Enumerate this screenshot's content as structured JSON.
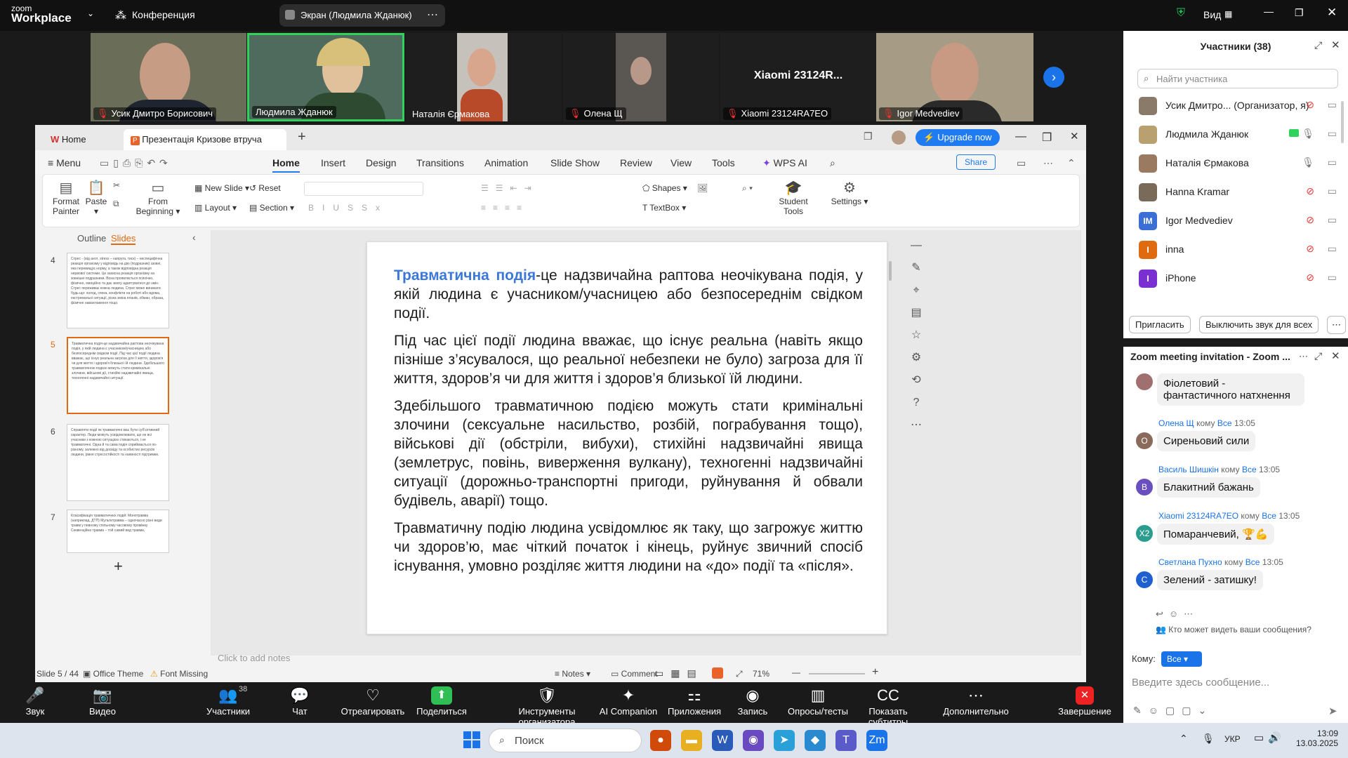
{
  "zoom": {
    "logo_top": "zoom",
    "logo_bottom": "Workplace",
    "conference_label": "Конференция",
    "screen_label": "Экран (Людмила Жданюк)",
    "view_label": "Вид",
    "participants": [
      {
        "name": "Усик Дмитро Борисович",
        "muted": true
      },
      {
        "name": "Людмила Жданюк",
        "muted": false
      },
      {
        "name": "Наталія Єрмакова",
        "muted": false
      },
      {
        "name": "Олена Щ",
        "muted": true
      },
      {
        "name": "Xiaomi 23124RA7EO",
        "muted": true,
        "center_label": "Xiaomi 23124R..."
      },
      {
        "name": "Igor Medvediev",
        "muted": true
      }
    ]
  },
  "wps": {
    "tabs": [
      {
        "label": "Home"
      },
      {
        "label": "Презентація Кризове втруча"
      }
    ],
    "upgrade": "Upgrade now",
    "menu": [
      "Menu",
      "Home",
      "Insert",
      "Design",
      "Transitions",
      "Animation",
      "Slide Show",
      "Review",
      "View",
      "Tools",
      "WPS AI"
    ],
    "share": "Share",
    "ribbon": {
      "format_painter": "Format Painter",
      "paste": "Paste",
      "from_beginning": "From Beginning",
      "new_slide": "New Slide",
      "layout": "Layout",
      "reset": "Reset",
      "section": "Section",
      "shapes": "Shapes",
      "textbox": "TextBox",
      "student_tools": "Student Tools",
      "settings": "Settings"
    },
    "panel_tabs": [
      "Outline",
      "Slides"
    ],
    "thumbs": [
      {
        "num": "4",
        "text": "Стрес - (від англ. stress – напруга, тиск) – неспецифічна реакція організму у відповідь на дію (подразник) ззовні, яка перевищує норму, а також відповідна реакція нервової системи. Це захисна реакція організму на зовнішні подразники. Вона проявляється психічно, фізично, емоційно та дає змогу адаптуватися до змін. Стрес переживає кожна людина. Стрес може виникати будь-що: холод, спека, конфлікти на роботі або вдома, екстремальні ситуації, різка зміна планів, обман, образа, фізичне навантаження тощо."
      },
      {
        "num": "5",
        "text": "Травматична подія-це надзвичайна раптова неочікувана подія, у якій людина є учасником/учасницею або безпосереднім свідком події. Під час цієї події людина вважає, що існує реальна загроза для її життя, здоров'я чи для життя і здоров'я близької їй людини. Здебільшого травматичною подією можуть стати кримінальні злочини, військові дії, стихійні надзвичайні явища, техногенні надзвичайні ситуації."
      },
      {
        "num": "6",
        "text": "Справляти події як травматичні має бути суб'єктивний характер. Люди можуть усвідомлювати, що не всі учасники з кожною ситуацією стикаються, і не травматичні. Одна й та сама подія сприймається по-різному, залежно від досвіду та особистих ресурсів людини, рівня стресостійкості та наявності підтримки."
      },
      {
        "num": "7",
        "text": "Класифікація травматичних подій: Монотравма (наприклад, ДТП) Мультитравма – одночасно різні види травм у певному спільному часовому проміжку Секвенційна травма – той самий вид травми,"
      }
    ],
    "slide": {
      "heading": "Травматична подія",
      "p1_rest": "-це надзвичайна раптова неочікувана подія, у якій людина є учасником/учасницею або безпосереднім свідком події.",
      "p2": "Під час цієї події людина вважає, що існує реальна (навіть якщо пізніше з’ясувалося, що реальної небезпеки не було) загроза для її життя, здоров’я чи для життя і здоров’я близької їй людини.",
      "p3": "Здебільшого травматичною подією можуть стати кримінальні злочини (сексуальне насильство, розбій, пограбування тощо), військові дії (обстріли, вибухи), стихійні надзвичайні явища (землетрус, повінь, виверження вулкану), техногенні надзвичайні ситуації (дорожньо-транспортні пригоди, руйнування й обвали будівель, аварії) тощо.",
      "p4": "Травматичну подію людина усвідомлює як таку, що загрожує життю чи здоров’ю, має чіткий початок і кінець, руйнує звичний спосіб існування, умовно розділяє життя людини на «до» події та «після»."
    },
    "notes_placeholder": "Click to add notes",
    "status": {
      "slide": "Slide 5 / 44",
      "theme": "Office Theme",
      "font": "Font Missing",
      "notes": "Notes",
      "comment": "Comment",
      "zoom": "71%"
    }
  },
  "panel": {
    "title": "Участники (38)",
    "search_placeholder": "Найти участника",
    "list": [
      {
        "name": "Усик Дмитро... (Организатор, я)",
        "initial": "",
        "color": "#8a7a6a"
      },
      {
        "name": "Людмила Жданюк",
        "initial": "",
        "color": "#b8a070"
      },
      {
        "name": "Наталія Єрмакова",
        "initial": "",
        "color": "#9a7a60"
      },
      {
        "name": "Hanna Kramar",
        "initial": "",
        "color": "#7a6a5a"
      },
      {
        "name": "Igor Medvediev",
        "initial": "IM",
        "color": "#3b6fd6"
      },
      {
        "name": "inna",
        "initial": "I",
        "color": "#e06a10"
      },
      {
        "name": "iPhone",
        "initial": "I",
        "color": "#7a2fd0"
      }
    ],
    "invite": "Пригласить",
    "mute_all": "Выключить звук для всех",
    "chat_title": "Zoom meeting invitation - Zoom ...",
    "messages": [
      {
        "sender": "",
        "to": "",
        "time": "",
        "text": "Фіолетовий - фантастичного натхнення",
        "initial": "",
        "color": "#a07070"
      },
      {
        "sender": "Олена Щ",
        "to": "Все",
        "time": "13:05",
        "text": "Сиреньовий сили",
        "initial": "О",
        "color": "#8a6a5a"
      },
      {
        "sender": "Василь Шишкін",
        "to": "Все",
        "time": "13:05",
        "text": "Блакитний бажань",
        "initial": "В",
        "color": "#6a4fc0"
      },
      {
        "sender": "Xiaomi 23124RA7EO",
        "to": "Все",
        "time": "13:05",
        "text": "Помаранчевий, 🏆💪",
        "initial": "X2",
        "color": "#2a9d8f"
      },
      {
        "sender": "Светлана Пухно",
        "to": "Все",
        "time": "13:05",
        "text": "Зелений - затишку!",
        "initial": "С",
        "color": "#1f5fd0"
      }
    ],
    "to_word": "кому",
    "who_sees": "Кто может видеть ваши сообщения?",
    "recipient_label": "Кому:",
    "recipient": "Все",
    "input_placeholder": "Введите здесь сообщение..."
  },
  "toolbar": [
    {
      "label": "Звук",
      "icon": "🎤"
    },
    {
      "label": "Видео",
      "icon": "📷"
    },
    {
      "label": "Участники",
      "icon": "👥",
      "badge": "38"
    },
    {
      "label": "Чат",
      "icon": "💬"
    },
    {
      "label": "Отреагировать",
      "icon": "♡"
    },
    {
      "label": "Поделиться",
      "icon": "⬆"
    },
    {
      "label": "Инструменты организатора",
      "icon": "🛡"
    },
    {
      "label": "AI Companion",
      "icon": "✦"
    },
    {
      "label": "Приложения",
      "icon": "⚏"
    },
    {
      "label": "Запись",
      "icon": "◉"
    },
    {
      "label": "Опросы/тесты",
      "icon": "▥"
    },
    {
      "label": "Показать субтитры",
      "icon": "CC"
    },
    {
      "label": "Дополнительно",
      "icon": "⋯"
    },
    {
      "label": "Завершение",
      "icon": "✕"
    }
  ],
  "taskbar": {
    "search": "Поиск",
    "lang": "УКР",
    "time": "13:09",
    "date": "13.03.2025"
  }
}
